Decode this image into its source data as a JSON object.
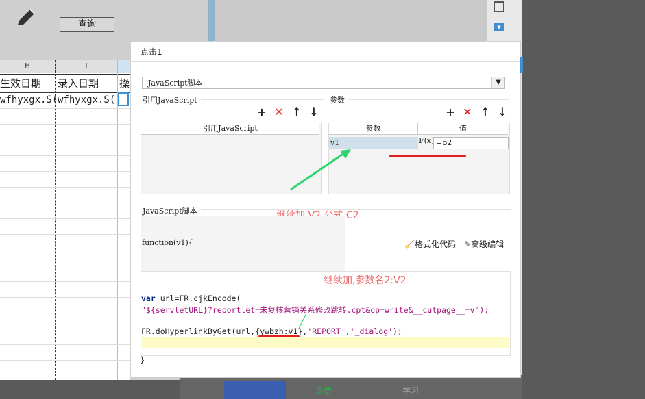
{
  "toolbar": {
    "query_label": "查询"
  },
  "sheet": {
    "col_h": "H",
    "col_i": "I",
    "title_effective": "生效日期",
    "title_entry": "录入日期",
    "title_op": "操",
    "cell_h": "wfhyxgx.S(",
    "cell_i": "wfhyxgx.S("
  },
  "dialog": {
    "title": "点击1",
    "type_select": "JavaScript脚本",
    "ref_js_section": "引用JavaScript",
    "params_section": "参数",
    "ref_js_column": "引用JavaScript",
    "param_col_name": "参数",
    "param_col_value": "值",
    "param_name": "v1",
    "param_fx": "F(x)",
    "param_value": "=b2",
    "script_section": "JavaScript脚本",
    "function_sig": "function(v1){",
    "format_code": "格式化代码",
    "advanced_edit": "高级编辑",
    "close_brace": "}"
  },
  "code": {
    "kw_var": "var",
    "line1_rest": " url=FR.cjkEncode(",
    "line2": "\"${servletURL}?reportlet=未复核营销关系修改跳转.cpt&op=write&__cutpage__=v\");",
    "line3_a": "FR.doHyperlinkByGet(url,",
    "line3_b": "{ywbzh:v1}",
    "line3_c": ",",
    "line3_d": "'REPORT'",
    "line3_e": ",",
    "line3_f": "'_dialog'",
    "line3_g": ");"
  },
  "annotations": {
    "note1": "继续加 V2 公式 C2",
    "note2": "继续加,参数名2:V2"
  },
  "bottom": {
    "free": "免费",
    "study": "学习"
  },
  "colors": {
    "accent": "#3e8ed0",
    "annotation": "#f06a6a",
    "arrow": "#2fd36f"
  }
}
